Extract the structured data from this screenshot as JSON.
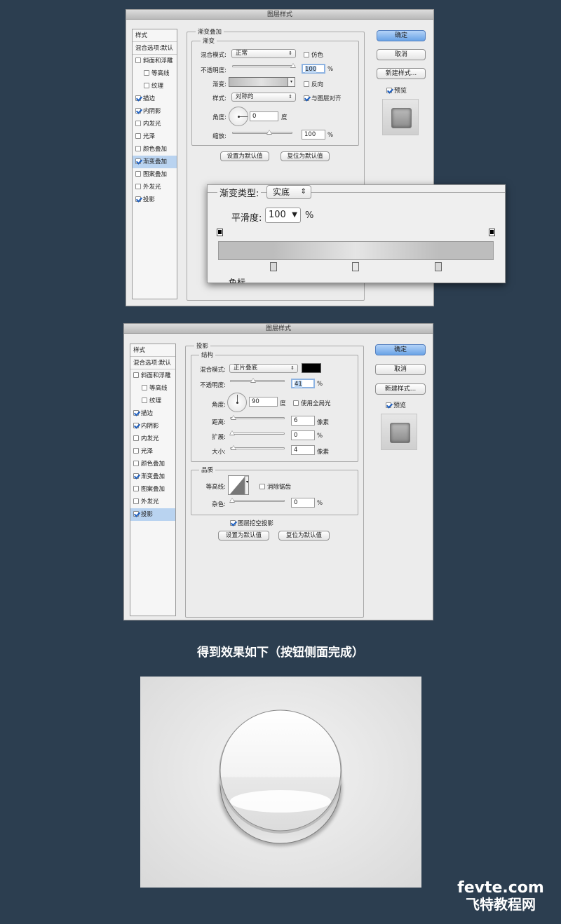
{
  "dialog1": {
    "title": "图层样式",
    "sidebar": [
      {
        "label": "样式",
        "type": "header"
      },
      {
        "label": "混合选项:默认",
        "type": "header"
      },
      {
        "label": "斜面和浮雕",
        "checked": false
      },
      {
        "label": "等高线",
        "checked": false,
        "indent": true
      },
      {
        "label": "纹理",
        "checked": false,
        "indent": true
      },
      {
        "label": "描边",
        "checked": true
      },
      {
        "label": "内阴影",
        "checked": true
      },
      {
        "label": "内发光",
        "checked": false
      },
      {
        "label": "光泽",
        "checked": false
      },
      {
        "label": "颜色叠加",
        "checked": false
      },
      {
        "label": "渐变叠加",
        "checked": true,
        "selected": true
      },
      {
        "label": "图案叠加",
        "checked": false
      },
      {
        "label": "外发光",
        "checked": false
      },
      {
        "label": "投影",
        "checked": true
      }
    ],
    "section_title": "渐变叠加",
    "group_title": "渐变",
    "blend_mode": {
      "label": "混合模式:",
      "value": "正常"
    },
    "dither": {
      "label": "仿色",
      "checked": false
    },
    "opacity": {
      "label": "不透明度:",
      "value": "100",
      "unit": "%",
      "level": 1.0
    },
    "gradient": {
      "label": "渐变:"
    },
    "reverse": {
      "label": "反向",
      "checked": false
    },
    "style": {
      "label": "样式:",
      "value": "对称的"
    },
    "align": {
      "label": "与图层对齐",
      "checked": true
    },
    "angle": {
      "label": "角度:",
      "value": "0",
      "unit": "度"
    },
    "scale": {
      "label": "缩放:",
      "value": "100",
      "unit": "%",
      "level": 0.5
    },
    "btn_default": "设置为默认值",
    "btn_reset": "复位为默认值",
    "ok": "确定",
    "cancel": "取消",
    "new_style": "新建样式...",
    "preview": {
      "label": "预览",
      "checked": true
    }
  },
  "callout": {
    "type_label": "渐变类型:",
    "type_value": "实底",
    "smooth_label": "平滑度:",
    "smooth_value": "100",
    "smooth_unit": "%",
    "partial_text": "色标"
  },
  "dialog2": {
    "title": "图层样式",
    "sidebar": [
      {
        "label": "样式",
        "type": "header"
      },
      {
        "label": "混合选项:默认",
        "type": "header"
      },
      {
        "label": "斜面和浮雕",
        "checked": false
      },
      {
        "label": "等高线",
        "checked": false,
        "indent": true
      },
      {
        "label": "纹理",
        "checked": false,
        "indent": true
      },
      {
        "label": "描边",
        "checked": true
      },
      {
        "label": "内阴影",
        "checked": true
      },
      {
        "label": "内发光",
        "checked": false
      },
      {
        "label": "光泽",
        "checked": false
      },
      {
        "label": "颜色叠加",
        "checked": false
      },
      {
        "label": "渐变叠加",
        "checked": true
      },
      {
        "label": "图案叠加",
        "checked": false
      },
      {
        "label": "外发光",
        "checked": false
      },
      {
        "label": "投影",
        "checked": true,
        "selected": true
      }
    ],
    "section_title": "投影",
    "group_structure": "结构",
    "blend_mode": {
      "label": "混合模式:",
      "value": "正片叠底",
      "color": "#000000"
    },
    "opacity": {
      "label": "不透明度:",
      "value": "41",
      "unit": "%",
      "level": 0.41
    },
    "angle": {
      "label": "角度:",
      "value": "90",
      "unit": "度"
    },
    "global_light": {
      "label": "使用全局光",
      "checked": false
    },
    "distance": {
      "label": "距离:",
      "value": "6",
      "unit": "像素",
      "level": 0.02
    },
    "spread": {
      "label": "扩展:",
      "value": "0",
      "unit": "%",
      "level": 0
    },
    "size": {
      "label": "大小:",
      "value": "4",
      "unit": "像素",
      "level": 0.02
    },
    "group_quality": "品质",
    "contour": {
      "label": "等高线:"
    },
    "antialias": {
      "label": "消除锯齿",
      "checked": false
    },
    "noise": {
      "label": "杂色:",
      "value": "0",
      "unit": "%",
      "level": 0
    },
    "knockout": {
      "label": "图层挖空投影",
      "checked": true
    },
    "btn_default": "设置为默认值",
    "btn_reset": "复位为默认值",
    "ok": "确定",
    "cancel": "取消",
    "new_style": "新建样式...",
    "preview": {
      "label": "预览",
      "checked": true
    }
  },
  "caption": "得到效果如下（按钮侧面完成）",
  "watermark": {
    "line1": "fevte.com",
    "line2": "飞特教程网"
  }
}
